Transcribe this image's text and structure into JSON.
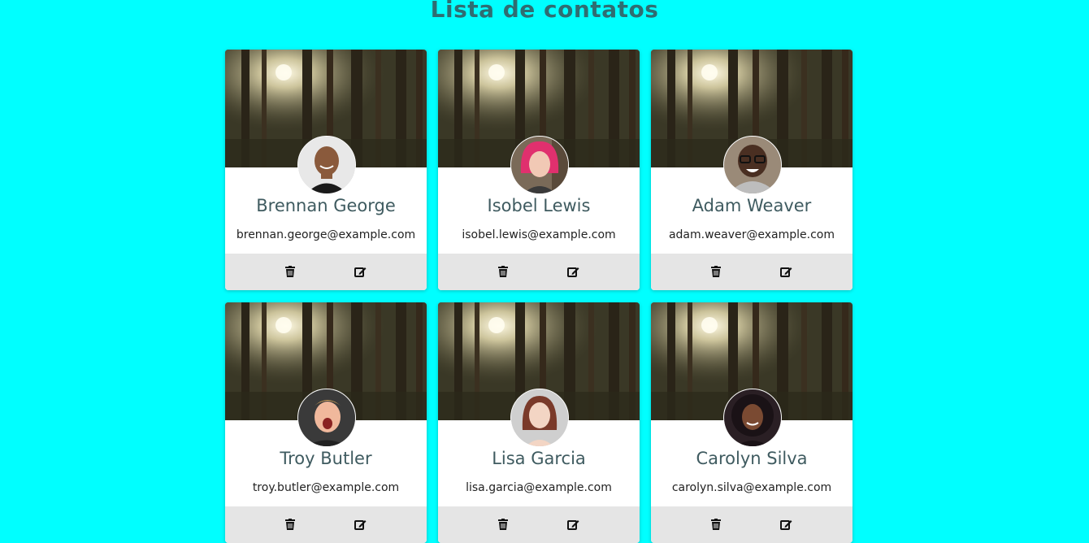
{
  "page": {
    "title": "Lista de contatos"
  },
  "contacts": [
    {
      "name": "Brennan George",
      "email": "brennan.george@example.com",
      "avatar": "avatar-bald-man"
    },
    {
      "name": "Isobel Lewis",
      "email": "isobel.lewis@example.com",
      "avatar": "avatar-pink-hair-woman"
    },
    {
      "name": "Adam Weaver",
      "email": "adam.weaver@example.com",
      "avatar": "avatar-man-glasses"
    },
    {
      "name": "Troy Butler",
      "email": "troy.butler@example.com",
      "avatar": "avatar-excited-man"
    },
    {
      "name": "Lisa Garcia",
      "email": "lisa.garcia@example.com",
      "avatar": "avatar-brown-hair-woman"
    },
    {
      "name": "Carolyn Silva",
      "email": "carolyn.silva@example.com",
      "avatar": "avatar-curly-hair-woman"
    }
  ],
  "icons": {
    "delete": "trash-icon",
    "edit": "edit-icon"
  },
  "colors": {
    "background": "#00ffff",
    "title": "#2f6d72",
    "name": "#3f5b60",
    "action_bar": "#e5e5e5"
  }
}
